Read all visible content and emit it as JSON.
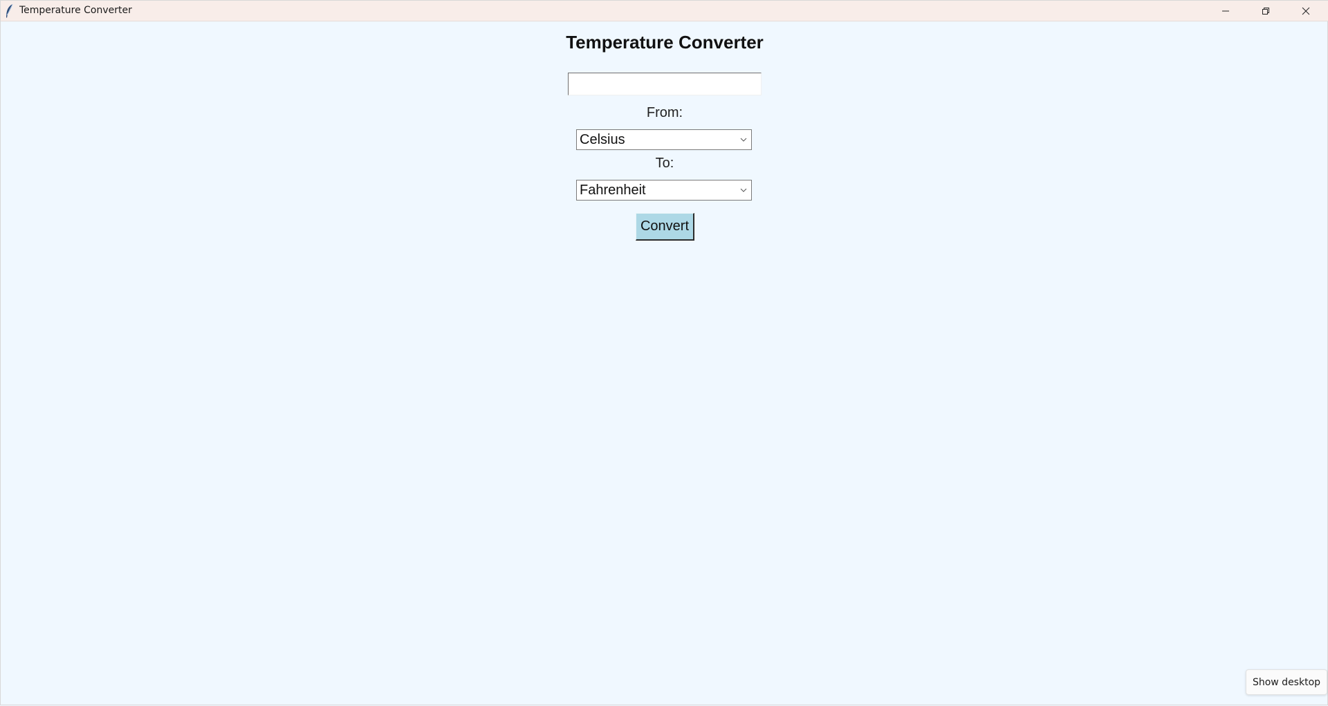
{
  "window": {
    "title": "Temperature Converter",
    "app_icon": "feather-icon",
    "controls": [
      "minimize-icon",
      "restore-icon",
      "close-icon"
    ]
  },
  "app": {
    "heading": "Temperature Converter",
    "input": {
      "value": "",
      "placeholder": ""
    },
    "from_label": "From:",
    "from_selected": "Celsius",
    "to_label": "To:",
    "to_selected": "Fahrenheit",
    "convert_label": "Convert"
  },
  "tooltip": {
    "text": "Show desktop"
  },
  "colors": {
    "background": "#f0f8ff",
    "titlebar": "#f8ede9",
    "button": "#add8e6"
  }
}
